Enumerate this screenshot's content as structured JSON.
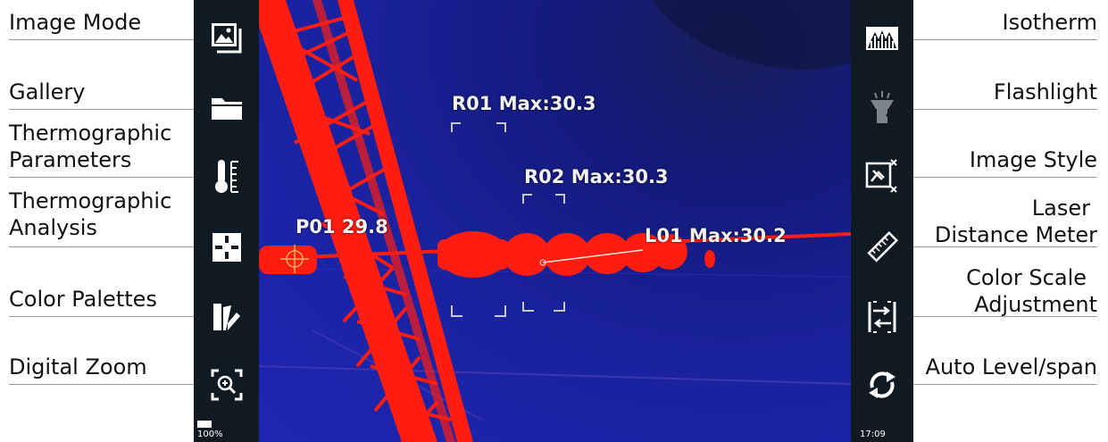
{
  "left_labels": [
    {
      "id": "image-mode",
      "text": "Image Mode"
    },
    {
      "id": "gallery",
      "text": "Gallery"
    },
    {
      "id": "thermographic-parameters",
      "line1": "Thermographic",
      "line2": "Parameters"
    },
    {
      "id": "thermographic-analysis",
      "line1": "Thermographic",
      "line2": "Analysis"
    },
    {
      "id": "color-palettes",
      "text": "Color Palettes"
    },
    {
      "id": "digital-zoom",
      "text": "Digital Zoom"
    }
  ],
  "right_labels": [
    {
      "id": "isotherm",
      "text": "Isotherm"
    },
    {
      "id": "flashlight",
      "text": "Flashlight"
    },
    {
      "id": "image-style",
      "text": "Image Style"
    },
    {
      "id": "laser-distance-meter",
      "line1": "Laser",
      "line2": "Distance Meter"
    },
    {
      "id": "color-scale-adjustment",
      "line1": "Color Scale",
      "line2": "Adjustment"
    },
    {
      "id": "auto-level-span",
      "text": "Auto Level/span"
    }
  ],
  "status": {
    "battery": "100%",
    "time": "17:09"
  },
  "measurements": {
    "r01": "R01 Max:30.3",
    "r02": "R02 Max:30.3",
    "p01": "P01 29.8",
    "l01": "L01 Max:30.2"
  },
  "icons": {
    "left": [
      "image-mode-icon",
      "gallery-folder-icon",
      "thermometer-icon",
      "analysis-crosshair-icon",
      "color-palette-icon",
      "digital-zoom-icon"
    ],
    "right": [
      "isotherm-icon",
      "flashlight-icon",
      "image-style-icon",
      "laser-distance-meter-icon",
      "color-scale-adjustment-icon",
      "auto-level-span-icon"
    ]
  },
  "colors": {
    "hot": "#ff1c10",
    "background": "#1d26b2",
    "rail": "#0f1a22"
  }
}
